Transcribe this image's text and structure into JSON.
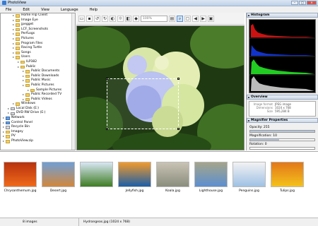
{
  "window": {
    "title": "PhotoView"
  },
  "menu": [
    "File",
    "Edit",
    "View",
    "Language",
    "Help"
  ],
  "tree": [
    {
      "label": "Home Flip Client",
      "level": 2,
      "type": "folder"
    },
    {
      "label": "Image Eye",
      "level": 2,
      "type": "folder"
    },
    {
      "label": "jpegget",
      "level": 2,
      "type": "folder"
    },
    {
      "label": "LCF_Screenshots",
      "level": 2,
      "type": "folder"
    },
    {
      "label": "PerfLogs",
      "level": 2,
      "type": "folder"
    },
    {
      "label": "Pictures",
      "level": 2,
      "type": "folder"
    },
    {
      "label": "Program Files",
      "level": 2,
      "type": "folder"
    },
    {
      "label": "Racing Turtle",
      "level": 2,
      "type": "folder"
    },
    {
      "label": "Songs",
      "level": 2,
      "type": "folder"
    },
    {
      "label": "Users",
      "level": 2,
      "type": "folder"
    },
    {
      "label": "ILP382",
      "level": 3,
      "type": "folder"
    },
    {
      "label": "Public",
      "level": 3,
      "type": "folder"
    },
    {
      "label": "Public Documents",
      "level": 4,
      "type": "folder"
    },
    {
      "label": "Public Downloads",
      "level": 4,
      "type": "folder"
    },
    {
      "label": "Public Music",
      "level": 4,
      "type": "folder"
    },
    {
      "label": "Public Pictures",
      "level": 4,
      "type": "folder"
    },
    {
      "label": "Sample Pictures",
      "level": 5,
      "type": "folder"
    },
    {
      "label": "Public Recorded TV",
      "level": 4,
      "type": "folder"
    },
    {
      "label": "Public Videos",
      "level": 4,
      "type": "folder"
    },
    {
      "label": "Windows",
      "level": 2,
      "type": "folder"
    },
    {
      "label": "Local Disk (E:)",
      "level": 1,
      "type": "drive"
    },
    {
      "label": "DVD RW Drive (E:)",
      "level": 1,
      "type": "drive"
    },
    {
      "label": "Network",
      "level": 0,
      "type": "net"
    },
    {
      "label": "Control Panel",
      "level": 0,
      "type": "net"
    },
    {
      "label": "Recycle Bin",
      "level": 0,
      "type": "drive"
    },
    {
      "label": "Imagey",
      "level": 0,
      "type": "folder"
    },
    {
      "label": "PV",
      "level": 0,
      "type": "folder"
    },
    {
      "label": "PhotoView.zip",
      "level": 0,
      "type": "folder"
    }
  ],
  "toolbar": {
    "zoom_value": "100%"
  },
  "histogram": {
    "title": "Histogram"
  },
  "overview": {
    "title": "Overview",
    "rows": [
      {
        "key": "Image format",
        "value": "JPEG image"
      },
      {
        "key": "Dimensions",
        "value": "1024 x 768"
      },
      {
        "key": "Size",
        "value": "595,284 B"
      }
    ]
  },
  "magnifier": {
    "title": "Magnifier Properties",
    "opacity_label": "Opacity: 255",
    "opacity": 1.0,
    "magnification_label": "Magnification: 10",
    "magnification": 0.45,
    "rotation_label": "Rotation: 0",
    "rotation": 0.0,
    "interpolated_label": "Interpolated"
  },
  "thumbnails": [
    {
      "name": "Chrysanthemum.jpg",
      "colors": [
        "#f06a1a",
        "#b8320e"
      ]
    },
    {
      "name": "Desert.jpg",
      "colors": [
        "#d2873c",
        "#6f9fd6"
      ]
    },
    {
      "name": "",
      "colors": [
        "#3e7d23",
        "#d8e6f4"
      ]
    },
    {
      "name": "Jellyfish.jpg",
      "colors": [
        "#1a5ea8",
        "#f39a2a"
      ]
    },
    {
      "name": "Koala.jpg",
      "colors": [
        "#8a8d7d",
        "#c9c3b4"
      ]
    },
    {
      "name": "Lighthouse.jpg",
      "colors": [
        "#5c8fd0",
        "#a5a58a"
      ]
    },
    {
      "name": "Penguins.jpg",
      "colors": [
        "#9ec1e4",
        "#f2f2f2"
      ]
    },
    {
      "name": "Tulips.jpg",
      "colors": [
        "#f4c21a",
        "#e27819"
      ]
    }
  ],
  "status": {
    "count": "8 images",
    "current": "Hydrangeas.jpg (1024 x 768)"
  }
}
